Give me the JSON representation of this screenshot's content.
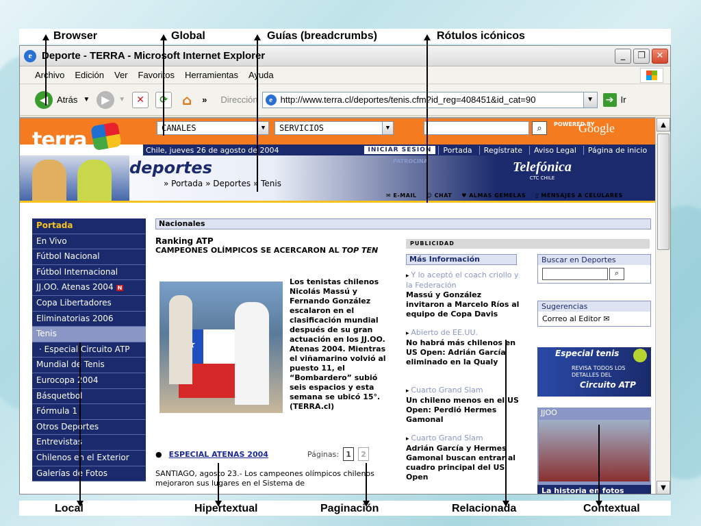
{
  "annotations": {
    "top": [
      "Browser",
      "Global",
      "Guías (breadcrumbs)",
      "Rótulos icónicos"
    ],
    "bottom": [
      "Local",
      "Hipertextual",
      "Paginación",
      "Relacionada",
      "Contextual"
    ]
  },
  "window": {
    "title": "Deporte - TERRA - Microsoft Internet Explorer",
    "menu": [
      "Archivo",
      "Edición",
      "Ver",
      "Favoritos",
      "Herramientas",
      "Ayuda"
    ],
    "back_label": "Atrás",
    "address_label": "Dirección",
    "url": "http://www.terra.cl/deportes/tenis.cfm?id_reg=408451&id_cat=90",
    "go_label": "Ir"
  },
  "site": {
    "logo": "terra",
    "canales": "CANALES",
    "servicios": "SERVICIOS",
    "powered_by": "POWERED BY",
    "google": "Google",
    "date": "Chile, jueves 26 de agosto de 2004",
    "login": "INICIAR SESION",
    "top_nav": [
      "Portada",
      "Regístrate",
      "Aviso Legal",
      "Página de inicio"
    ],
    "section_title": "deportes",
    "breadcrumbs": [
      "Portada",
      "Deportes",
      "Tenis"
    ],
    "patrocina": "PATROCINA",
    "sponsor": "Telefónica",
    "sponsor_sub": "CTC CHILE",
    "tools": [
      "E-MAIL",
      "CHAT",
      "ALMAS GEMELAS",
      "MENSAJES A CELULARES"
    ]
  },
  "leftnav": [
    "Portada",
    "En Vivo",
    "Fútbol Nacional",
    "Fútbol Internacional",
    "JJ.OO. Atenas 2004",
    "Copa Libertadores",
    "Eliminatorias 2006",
    "Tenis",
    "· Especial Circuito ATP",
    "Mundial de Tenis",
    "Eurocopa 2004",
    "Básquetbol",
    "Fórmula 1",
    "Otros Deportes",
    "Entrevistas",
    "Chilenos en el Exterior",
    "Galerías de Fotos"
  ],
  "main": {
    "section": "Nacionales",
    "kicker": "Ranking ATP",
    "title_prefix": "CAMPEONES OLÍMPICOS SE ACERCARON AL ",
    "title_italic": "TOP TEN",
    "body": "Los tenistas chilenos Nicolás Massú y Fernando González escalaron en el clasificación mundial después de su gran actuación en los JJ.OO. Atenas 2004. Mientras el viñamarino volvió al puesto 11, el “Bombardero” subió seis espacios y esta semana se ubicó 15°. (TERRA.cl)",
    "especial_link": "ESPECIAL ATENAS 2004",
    "paginas_label": "Páginas:",
    "pages": [
      "1",
      "2"
    ],
    "dateline": "SANTIAGO, agosto 23.- Los campeones olímpicos chilenos mejoraron sus lugares en el Sistema de"
  },
  "related": {
    "publicidad": "PUBLICIDAD",
    "heading": "Más Información",
    "items": [
      {
        "cat": "Y lo aceptó el coach criollo y la Federación",
        "headline": "Massú y González invitaron a Marcelo Ríos al equipo de Copa Davis"
      },
      {
        "cat": "Abierto de EE.UU.",
        "headline": "No habrá más chilenos en US Open: Adrián García eliminado en la Qualy"
      },
      {
        "cat": "Cuarto Grand Slam",
        "headline": "Un chileno menos en el US Open: Perdió Hermes Gamonal"
      },
      {
        "cat": "Cuarto Grand Slam",
        "headline": "Adrián García y Hermes Gamonal buscan entrar al cuadro principal del US Open"
      }
    ]
  },
  "right": {
    "buscar": "Buscar en Deportes",
    "sugerencias": "Sugerencias",
    "correo": "Correo al Editor",
    "especial_title": "Especial tenis",
    "especial_text": "REVISA TODOS LOS DETALLES DEL",
    "especial_link": "Circuito ATP",
    "jjoo": "JJOO",
    "jjoo_caption": "La historia en fotos"
  }
}
